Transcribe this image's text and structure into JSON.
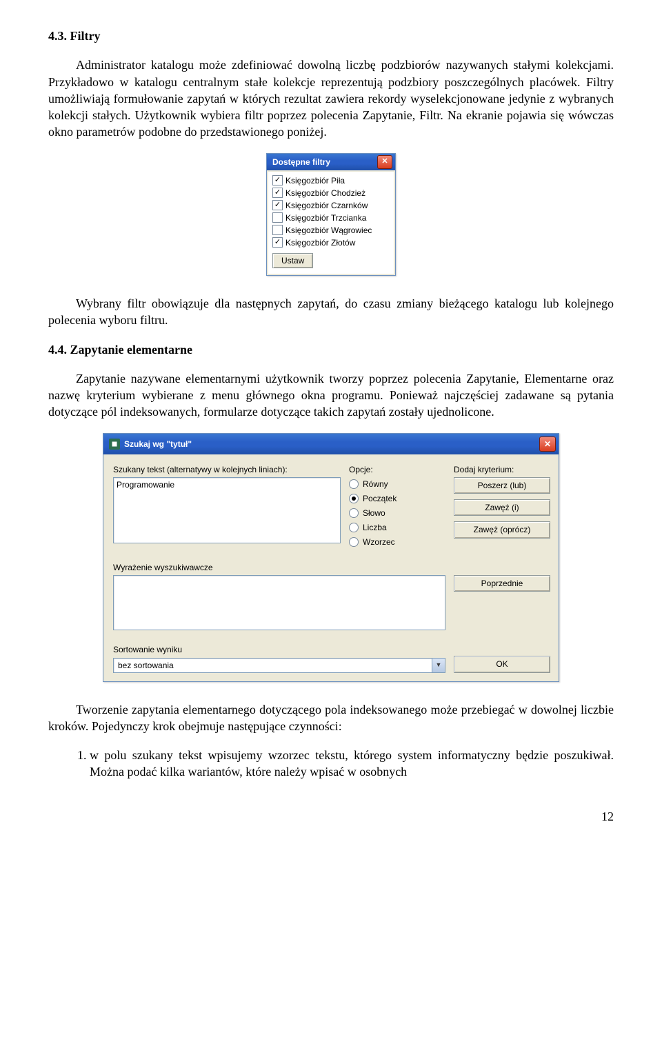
{
  "section1": {
    "heading": "4.3. Filtry",
    "p1": "Administrator katalogu może zdefiniować dowolną liczbę podzbiorów nazywanych stałymi kolekcjami. Przykładowo w katalogu centralnym stałe kolekcje reprezentują podzbiory poszczególnych placówek. Filtry umożliwiają formułowanie zapytań w których rezultat zawiera rekordy wyselekcjonowane jedynie z wybranych kolekcji stałych. Użytkownik wybiera filtr poprzez polecenia Zapytanie, Filtr. Na ekranie pojawia się wówczas okno parametrów podobne do przedstawionego poniżej."
  },
  "dlg1": {
    "title": "Dostępne filtry",
    "items": [
      {
        "label": "Księgozbiór Piła",
        "checked": true
      },
      {
        "label": "Księgozbiór Chodzież",
        "checked": true
      },
      {
        "label": "Księgozbiór Czarnków",
        "checked": true
      },
      {
        "label": "Księgozbiór Trzcianka",
        "checked": false
      },
      {
        "label": "Księgozbiór Wągrowiec",
        "checked": false
      },
      {
        "label": "Księgozbiór Złotów",
        "checked": true
      }
    ],
    "btn": "Ustaw"
  },
  "section2": {
    "p2": "Wybrany filtr obowiązuje dla następnych zapytań, do czasu zmiany bieżącego katalogu lub kolejnego polecenia wyboru filtru.",
    "heading": "4.4. Zapytanie elementarne",
    "p3": "Zapytanie nazywane elementarnymi użytkownik tworzy poprzez polecenia Zapytanie, Elementarne oraz nazwę kryterium wybierane z menu głównego okna programu. Ponieważ najczęściej zadawane są pytania dotyczące pól indeksowanych, formularze dotyczące takich zapytań zostały ujednolicone."
  },
  "dlg2": {
    "title": "Szukaj wg \"tytuł\"",
    "label_text": "Szukany tekst (alternatywy w kolejnych liniach):",
    "text_value": "Programowanie",
    "label_opts": "Opcje:",
    "opts": [
      "Równy",
      "Początek",
      "Słowo",
      "Liczba",
      "Wzorzec"
    ],
    "opt_selected": 1,
    "label_add": "Dodaj kryterium:",
    "btn_poszerz": "Poszerz (lub)",
    "btn_zawez_i": "Zawęż (i)",
    "btn_zawez_opr": "Zawęż (oprócz)",
    "label_expr": "Wyrażenie wyszukiwawcze",
    "btn_prev": "Poprzednie",
    "label_sort": "Sortowanie wyniku",
    "sort_value": "bez sortowania",
    "btn_ok": "OK"
  },
  "section3": {
    "p4": "Tworzenie zapytania elementarnego dotyczącego pola indeksowanego może przebiegać w dowolnej liczbie kroków. Pojedynczy krok obejmuje następujące czynności:",
    "li1": "w polu szukany tekst wpisujemy wzorzec tekstu, którego system informatyczny będzie poszukiwał. Można podać kilka wariantów, które należy wpisać w osobnych"
  },
  "page_number": "12"
}
